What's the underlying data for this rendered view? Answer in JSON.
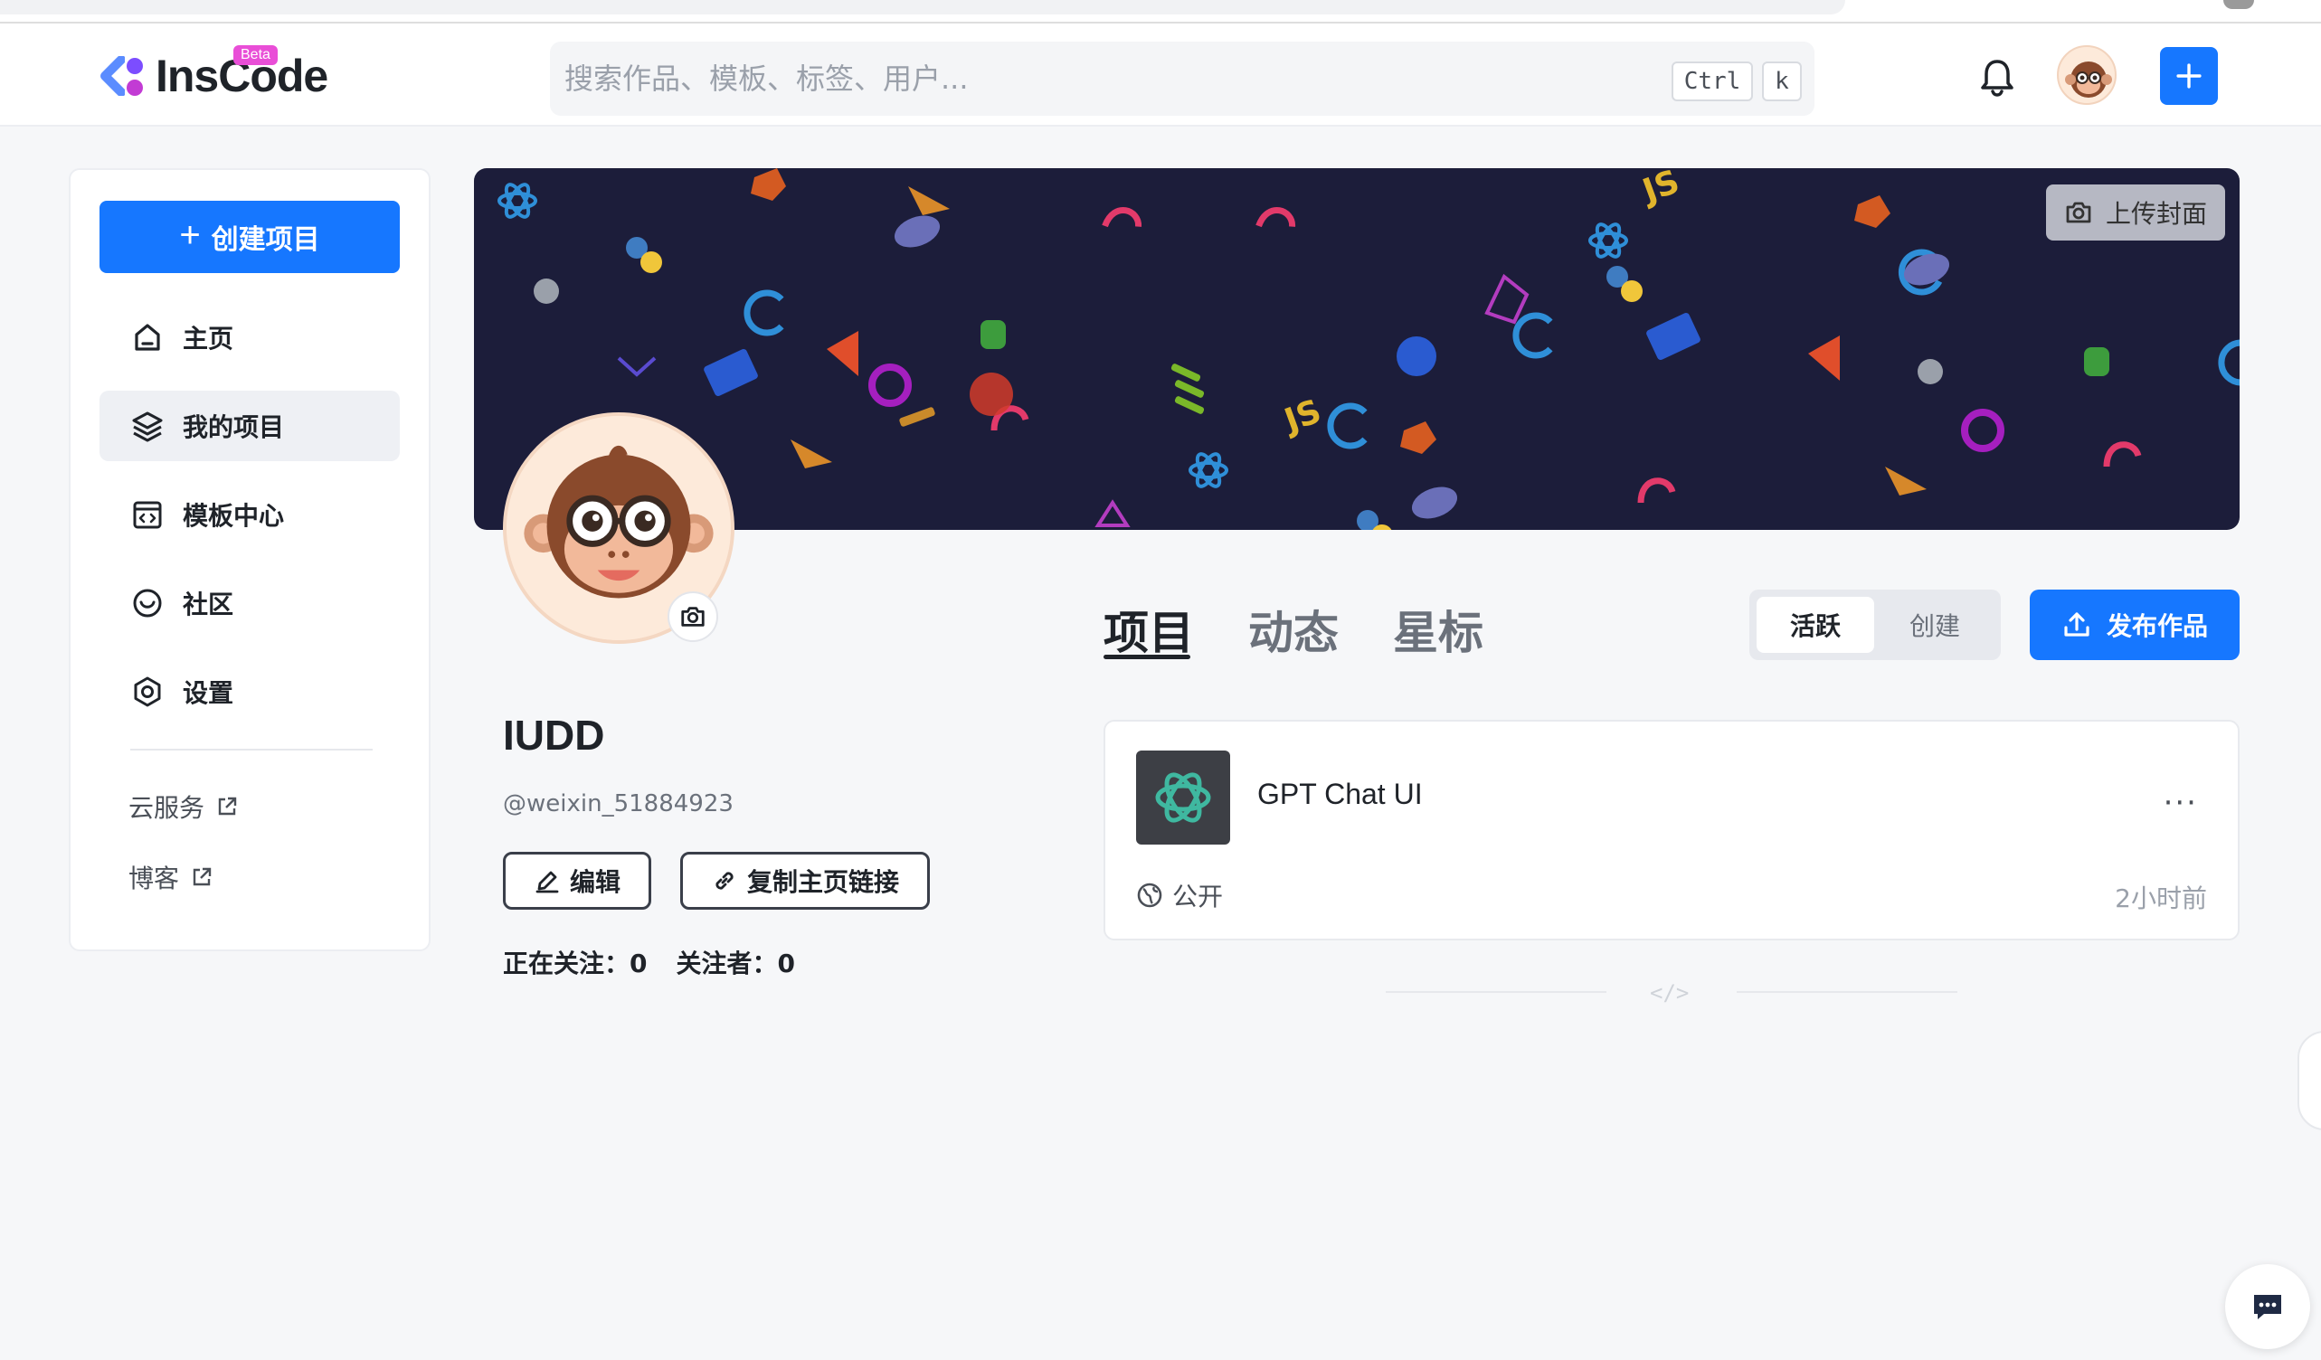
{
  "header": {
    "logo_text": "InsCode",
    "beta_badge": "Beta",
    "search_placeholder": "搜索作品、模板、标签、用户...",
    "shortcut_ctrl": "Ctrl",
    "shortcut_key": "k",
    "icons": [
      "bell-icon",
      "avatar",
      "plus-icon"
    ]
  },
  "sidebar": {
    "create_label": "创建项目",
    "items": [
      {
        "label": "主页",
        "icon": "home-icon"
      },
      {
        "label": "我的项目",
        "icon": "layers-icon",
        "active": true
      },
      {
        "label": "模板中心",
        "icon": "template-icon"
      },
      {
        "label": "社区",
        "icon": "community-icon"
      },
      {
        "label": "设置",
        "icon": "settings-icon"
      }
    ],
    "links": [
      {
        "label": "云服务",
        "icon": "external-link-icon"
      },
      {
        "label": "博客",
        "icon": "external-link-icon"
      }
    ]
  },
  "banner": {
    "upload_cover_label": "上传封面",
    "background_color": "#1c1d3a"
  },
  "profile": {
    "name": "IUDD",
    "handle": "@weixin_51884923",
    "edit_label": "编辑",
    "copy_link_label": "复制主页链接",
    "following_label": "正在关注：",
    "following_count": "0",
    "followers_label": "关注者：",
    "followers_count": "0"
  },
  "tabs": [
    {
      "label": "项目",
      "active": true
    },
    {
      "label": "动态"
    },
    {
      "label": "星标"
    }
  ],
  "sort": {
    "active_label": "活跃",
    "created_label": "创建"
  },
  "publish_label": "发布作品",
  "projects": [
    {
      "title": "GPT Chat UI",
      "visibility": "公开",
      "time": "2小时前",
      "more": "···"
    }
  ],
  "end_marker": "</>",
  "colors": {
    "primary": "#1677ff",
    "beta": "#e94ed7",
    "logo_purple": "#7c4dff",
    "logo_magenta": "#c23bd4"
  }
}
